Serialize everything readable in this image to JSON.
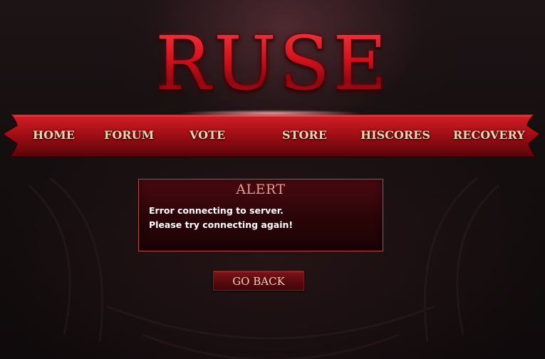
{
  "logo": {
    "text": "RUSE"
  },
  "nav": {
    "items": [
      {
        "label": "HOME"
      },
      {
        "label": "FORUM"
      },
      {
        "label": "VOTE"
      },
      {
        "label": "STORE"
      },
      {
        "label": "HISCORES"
      },
      {
        "label": "RECOVERY"
      }
    ]
  },
  "alert": {
    "title": "ALERT",
    "lines": [
      "Error connecting to server.",
      "Please try connecting again!"
    ]
  },
  "go_back": {
    "label": "GO BACK"
  },
  "colors": {
    "accent": "#b8121a",
    "nav_text": "#e9d3b3",
    "alert_title": "#e99a90",
    "background": "#120d0e"
  }
}
